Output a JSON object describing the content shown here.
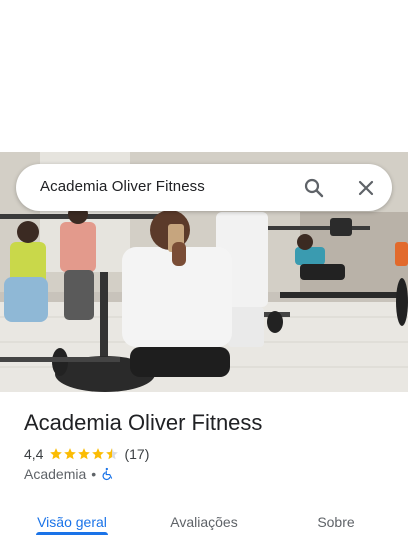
{
  "search": {
    "query": "Academia Oliver Fitness",
    "search_icon": "search-icon",
    "close_icon": "close-icon"
  },
  "place": {
    "title": "Academia Oliver Fitness",
    "rating": "4,4",
    "stars": 4.5,
    "review_count": "(17)",
    "category": "Academia",
    "separator": "•",
    "accessibility_icon": "wheelchair-icon"
  },
  "tabs": [
    {
      "label": "Visão geral",
      "active": true
    },
    {
      "label": "Avaliações",
      "active": false
    },
    {
      "label": "Sobre",
      "active": false
    }
  ],
  "colors": {
    "accent": "#1a73e8",
    "star": "#fbbc04",
    "text": "#202124",
    "secondary": "#5f6368"
  }
}
